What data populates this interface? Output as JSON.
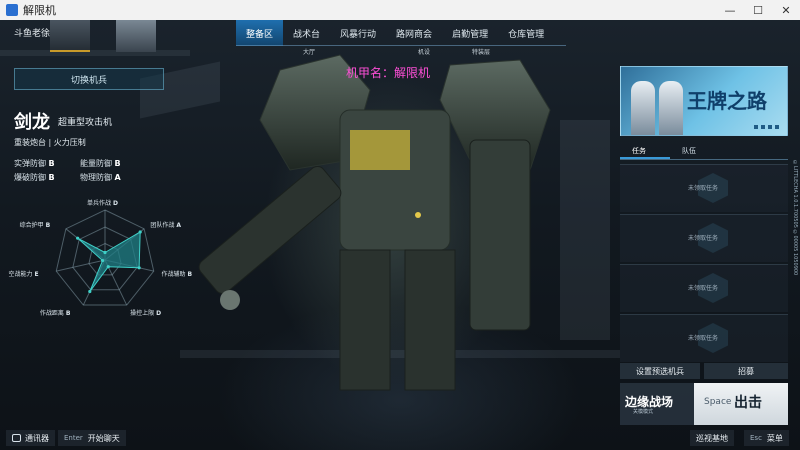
{
  "window": {
    "title": "解限机",
    "min": "—",
    "max": "☐",
    "close": "✕"
  },
  "player": {
    "name": "斗鱼老徐"
  },
  "nav": {
    "tabs": [
      {
        "label": "整备区",
        "active": true
      },
      {
        "label": "战术台",
        "active": false
      },
      {
        "label": "风暴行动",
        "active": false
      },
      {
        "label": "路网商会",
        "active": false
      },
      {
        "label": "启勤管理",
        "active": false
      },
      {
        "label": "仓库管理",
        "active": false
      }
    ],
    "sub": {
      "hall": "大厅",
      "mech": "机设",
      "special": "特装层"
    }
  },
  "overlay": {
    "mech_name": "机甲名：解限机"
  },
  "left": {
    "switch_label": "切换机兵",
    "mech_name": "剑龙",
    "mech_class": "超重型攻击机",
    "traits": "重装炮台 | 火力压制",
    "stats": [
      {
        "label": "实弹防御",
        "grade": "B"
      },
      {
        "label": "能量防御",
        "grade": "B"
      },
      {
        "label": "爆破防御",
        "grade": "B"
      },
      {
        "label": "物理防御",
        "grade": "A"
      }
    ]
  },
  "chart_data": {
    "type": "radar",
    "axes": [
      {
        "label": "单兵作战",
        "grade": "D",
        "value": 0.15
      },
      {
        "label": "团队作战",
        "grade": "A",
        "value": 0.9
      },
      {
        "label": "作战辅助",
        "grade": "B",
        "value": 0.7
      },
      {
        "label": "操控上限",
        "grade": "D",
        "value": 0.15
      },
      {
        "label": "作战距离",
        "grade": "B",
        "value": 0.7
      },
      {
        "label": "空战能力",
        "grade": "E",
        "value": 0.05
      },
      {
        "label": "综合护甲",
        "grade": "B",
        "value": 0.7
      }
    ],
    "colors": {
      "fill": "#1f7f86",
      "stroke": "#3fd0c8",
      "grid": "#8aa4b0"
    }
  },
  "right": {
    "banner_text": "王牌之路",
    "task_tabs": [
      "任务",
      "队伍"
    ],
    "tasks": [
      "未领取任务",
      "未领取任务",
      "未领取任务",
      "未领取任务"
    ],
    "side_text": "©LITTLECHA 1.0.1.700505 ©00005 1050900",
    "preset_label": "设置预选机兵",
    "recruit_label": "招募",
    "battle_name": "边缘战场",
    "battle_mode": "关模模式",
    "space_key": "Space",
    "go_label": "出击"
  },
  "bottom": {
    "comm_label": "通讯器",
    "enter_key": "Enter",
    "chat_label": "开始聊天",
    "base_label": "巡视基地",
    "esc_key": "Esc",
    "menu_label": "菜单"
  }
}
